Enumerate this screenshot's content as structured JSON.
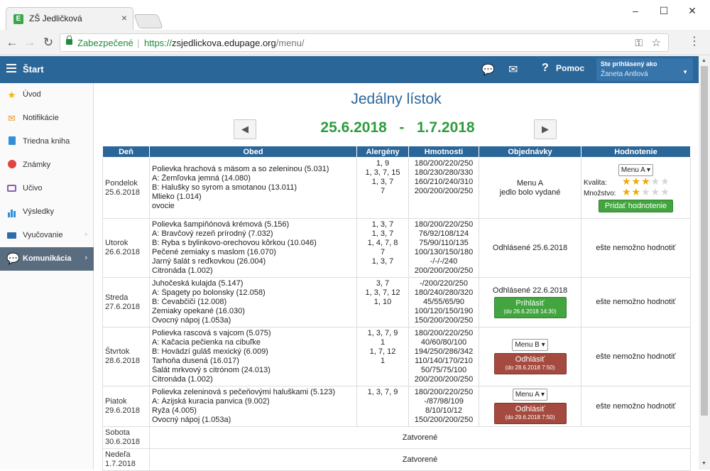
{
  "browser": {
    "tab_title": "ZŠ Jedličková",
    "favicon_letter": "E",
    "secure_label": "Zabezpečené",
    "url_scheme": "https://",
    "url_host": "zsjedlickova.edupage.org",
    "url_path": "/menu/"
  },
  "header": {
    "start_label": "Štart",
    "help_label": "Pomoc",
    "logged_in_caption": "Ste prihlásený ako",
    "user_name": "Žaneta Antlová"
  },
  "sidebar": {
    "items": [
      {
        "label": "Úvod",
        "icon": "star-icon",
        "color": "#f2b200"
      },
      {
        "label": "Notifikácie",
        "icon": "envelope-icon",
        "color": "#e8952c"
      },
      {
        "label": "Triedna kniha",
        "icon": "book-icon",
        "color": "#2f8fd8"
      },
      {
        "label": "Známky",
        "icon": "chart-icon",
        "color": "#e04545"
      },
      {
        "label": "Učivo",
        "icon": "study-icon",
        "color": "#8e5bb5"
      },
      {
        "label": "Výsledky",
        "icon": "bar-chart-icon",
        "color": "#2f8fd8"
      },
      {
        "label": "Vyučovanie",
        "icon": "open-book-icon",
        "color": "#2f6da8"
      },
      {
        "label": "Komunikácia",
        "icon": "speech-bubbles-icon",
        "color": "#ffffff"
      }
    ]
  },
  "page": {
    "title": "Jedálny lístok",
    "date_from": "25.6.2018",
    "date_sep": "-",
    "date_to": "1.7.2018"
  },
  "table": {
    "headers": [
      "Deň",
      "Obed",
      "Alergény",
      "Hmotnosti",
      "Objednávky",
      "Hodnotenie"
    ],
    "rows": [
      {
        "day": "Pondelok",
        "date": "25.6.2018",
        "foods": [
          "Polievka hrachová s mäsom a so zeleninou (5.031)",
          "A: Žemľovka jemná (14.080)",
          "B: Halušky so syrom a smotanou (13.011)",
          "Mlieko (1.014)",
          "ovocie"
        ],
        "allergens": [
          "1, 9",
          "1, 3, 7, 15",
          "1, 3, 7",
          "7"
        ],
        "weights": [
          "180/200/220/250",
          "180/230/280/330",
          "160/210/240/310",
          "200/200/200/250"
        ],
        "order_menu": "Menu A",
        "order_status": "jedlo bolo vydané",
        "rating_select": "Menu A",
        "quality_label": "Kvalita:",
        "quality_stars": 3,
        "quantity_label": "Množstvo:",
        "quantity_stars": 2,
        "rating_button": "Pridať hodnotenie"
      },
      {
        "day": "Utorok",
        "date": "26.6.2018",
        "foods": [
          "Polievka šampiňónová krémová (5.156)",
          "A: Bravčový rezeň prírodný (7.032)",
          "B: Ryba s bylinkovo-orechovou kôrkou (10.046)",
          "Pečené zemiaky s maslom (16.070)",
          "Jarný šalát s reďkovkou (26.004)",
          "Citronáda (1.002)"
        ],
        "allergens": [
          "1, 3, 7",
          "1, 3, 7",
          "1, 4, 7, 8",
          "7",
          "1, 3, 7",
          ""
        ],
        "weights": [
          "180/200/220/250",
          "76/92/108/124",
          "75/90/110/135",
          "100/130/150/180",
          "-/-/-/240",
          "200/200/200/250"
        ],
        "order_status": "Odhlásené 25.6.2018",
        "rating_text": "ešte nemožno hodnotiť"
      },
      {
        "day": "Streda",
        "date": "27.6.2018",
        "foods": [
          "Juhočeská kulajda (5.147)",
          "A: Špagety po bolonsky (12.058)",
          "B: Čevabčiči (12.008)",
          "Zemiaky opekané (16.030)",
          "Ovocný nápoj (1.053a)"
        ],
        "allergens": [
          "3, 7",
          "1, 3, 7, 12",
          "1, 10",
          "",
          ""
        ],
        "weights": [
          "-/200/220/250",
          "180/240/280/320",
          "45/55/65/90",
          "100/120/150/190",
          "150/200/200/250"
        ],
        "order_status": "Odhlásené 22.6.2018",
        "order_button": "Prihlásiť",
        "order_button_sub": "(do 26.6.2018 14:30)",
        "rating_text": "ešte nemožno hodnotiť"
      },
      {
        "day": "Štvrtok",
        "date": "28.6.2018",
        "foods": [
          "Polievka rascová s vajcom (5.075)",
          "A: Kačacia pečienka na cibuľke",
          "B: Hovädzí guláš mexický (6.009)",
          "Tarhoňa dusená (16.017)",
          "Šalát mrkvový s citrónom (24.013)",
          "Citronáda (1.002)"
        ],
        "allergens": [
          "1, 3, 7, 9",
          "1",
          "1, 7, 12",
          "1",
          "",
          ""
        ],
        "weights": [
          "180/200/220/250",
          "40/60/80/100",
          "194/250/286/342",
          "110/140/170/210",
          "50/75/75/100",
          "200/200/200/250"
        ],
        "order_menu": "Menu B",
        "order_button": "Odhlásiť",
        "order_button_sub": "(do 28.6.2018 7:50)",
        "rating_text": "ešte nemožno hodnotiť"
      },
      {
        "day": "Piatok",
        "date": "29.6.2018",
        "foods": [
          "Polievka zeleninová s pečeňovými haluškami (5.123)",
          "A: Ázijská kuracia panvica (9.002)",
          "Ryža (4.005)",
          "Ovocný nápoj (1.053a)"
        ],
        "allergens": [
          "1, 3, 7, 9",
          "",
          "",
          ""
        ],
        "weights": [
          "180/200/220/250",
          "-/87/98/109",
          "8/10/10/12",
          "150/200/200/250"
        ],
        "order_menu": "Menu A",
        "order_button": "Odhlásiť",
        "order_button_sub": "(do 29.6.2018 7:50)",
        "rating_text": "ešte nemožno hodnotiť"
      }
    ],
    "closed_rows": [
      {
        "day": "Sobota",
        "date": "30.6.2018",
        "text": "Zatvorené"
      },
      {
        "day": "Nedeľa",
        "date": "1.7.2018",
        "text": "Zatvorené"
      }
    ]
  },
  "colors": {
    "brand_blue": "#2b6699",
    "date_green": "#2e9c3f",
    "button_green": "#42a53f",
    "button_red": "#a44a3f",
    "star_gold": "#f2a600"
  }
}
